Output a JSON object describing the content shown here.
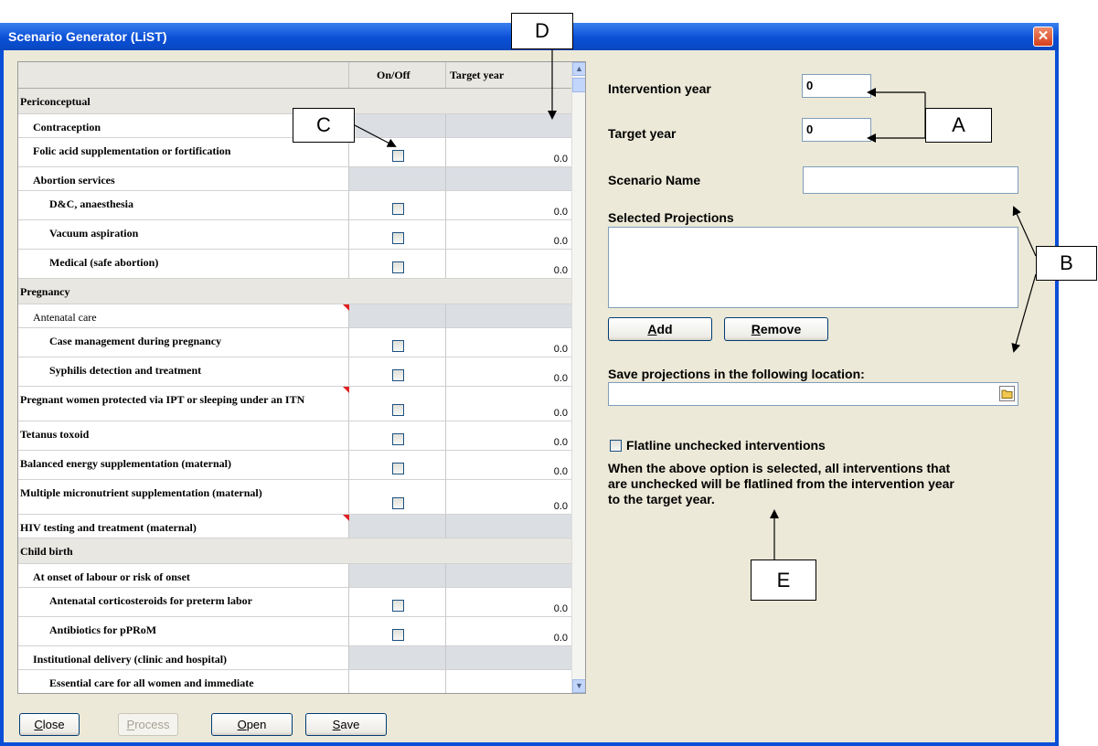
{
  "window": {
    "title": "Scenario Generator (LiST)",
    "close_glyph": "✕"
  },
  "grid": {
    "headers": {
      "name": "",
      "onoff": "On/Off",
      "target": "Target year"
    },
    "rows": [
      {
        "label": "Periconceptual",
        "kind": "category",
        "indent": 0
      },
      {
        "label": "Contraception",
        "kind": "group",
        "indent": 1
      },
      {
        "label": "Folic acid supplementation or fortification",
        "kind": "item",
        "indent": 1,
        "value": "0.0"
      },
      {
        "label": "Abortion services",
        "kind": "group",
        "indent": 1
      },
      {
        "label": "D&C, anaesthesia",
        "kind": "item",
        "indent": 2,
        "value": "0.0"
      },
      {
        "label": "Vacuum aspiration",
        "kind": "item",
        "indent": 2,
        "value": "0.0"
      },
      {
        "label": "Medical (safe abortion)",
        "kind": "item",
        "indent": 2,
        "value": "0.0"
      },
      {
        "label": "Pregnancy",
        "kind": "category",
        "indent": 0
      },
      {
        "label": "Antenatal care",
        "kind": "group",
        "indent": 1,
        "normal": true,
        "note": true
      },
      {
        "label": "Case management during pregnancy",
        "kind": "item",
        "indent": 2,
        "value": "0.0"
      },
      {
        "label": "Syphilis detection and treatment",
        "kind": "item",
        "indent": 2,
        "value": "0.0"
      },
      {
        "label": "Pregnant women protected via IPT or sleeping under an ITN",
        "kind": "item",
        "indent": 0,
        "value": "0.0",
        "note": true,
        "tall": true
      },
      {
        "label": "Tetanus toxoid",
        "kind": "item",
        "indent": 0,
        "value": "0.0"
      },
      {
        "label": "Balanced energy supplementation (maternal)",
        "kind": "item",
        "indent": 0,
        "value": "0.0"
      },
      {
        "label": "Multiple micronutrient supplementation (maternal)",
        "kind": "item",
        "indent": 0,
        "value": "0.0",
        "tall": true
      },
      {
        "label": "HIV testing and treatment (maternal)",
        "kind": "group",
        "indent": 0,
        "note": true
      },
      {
        "label": "Child birth",
        "kind": "category",
        "indent": 0
      },
      {
        "label": "At onset of labour or risk of onset",
        "kind": "group",
        "indent": 1
      },
      {
        "label": "Antenatal corticosteroids for preterm labor",
        "kind": "item",
        "indent": 2,
        "value": "0.0"
      },
      {
        "label": "Antibiotics for pPRoM",
        "kind": "item",
        "indent": 2,
        "value": "0.0"
      },
      {
        "label": "Institutional delivery (clinic and hospital)",
        "kind": "group",
        "indent": 1
      },
      {
        "label": "Essential care for all women and immediate",
        "kind": "partial",
        "indent": 2
      }
    ],
    "scroll_up": "▲",
    "scroll_down": "▼"
  },
  "form": {
    "intervention_year_label": "Intervention year",
    "intervention_year_value": "0",
    "target_year_label": "Target year",
    "target_year_value": "0",
    "scenario_name_label": "Scenario Name",
    "scenario_name_value": "",
    "selected_projections_label": "Selected Projections",
    "add_label_u": "A",
    "add_label_rest": "dd",
    "remove_label_u": "R",
    "remove_label_rest": "emove",
    "save_location_label": "Save projections in the following location:",
    "save_location_value": "",
    "flatline_label": "Flatline unchecked interventions",
    "flatline_checked": false,
    "note_line1": "When the above option is selected, all interventions that",
    "note_line2": "are unchecked will be flatlined from the intervention year",
    "note_line3": "to the target year."
  },
  "bottom_buttons": [
    {
      "u": "C",
      "rest": "lose",
      "enabled": true
    },
    {
      "u": "P",
      "rest": "rocess",
      "enabled": false
    },
    {
      "u": "O",
      "rest": "pen",
      "enabled": true
    },
    {
      "u": "S",
      "rest": "ave",
      "enabled": true
    }
  ],
  "callouts": {
    "a": "A",
    "b": "B",
    "c": "C",
    "d": "D",
    "e": "E"
  }
}
